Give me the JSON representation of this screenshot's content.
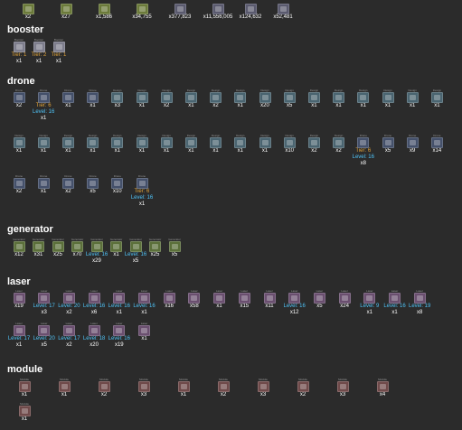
{
  "colors": {
    "background": "#2b2b2b",
    "text": "#ffffff",
    "tier": "#e0a33a",
    "level": "#4fc3f7",
    "label": "#9a9a9a"
  },
  "top_items": [
    {
      "icon": "cube-icon",
      "qty": "x2"
    },
    {
      "icon": "cube-icon",
      "qty": "x27"
    },
    {
      "icon": "cube-icon",
      "qty": "x1,586"
    },
    {
      "icon": "cube-icon",
      "qty": "x34,755"
    },
    {
      "icon": "ammo-icon",
      "qty": "x377,823"
    },
    {
      "icon": "ammo-icon",
      "qty": "x11,556,005"
    },
    {
      "icon": "ammo-icon",
      "qty": "x124,632"
    },
    {
      "icon": "ammo-icon",
      "qty": "x52,481"
    }
  ],
  "sections": {
    "booster": {
      "title": "booster",
      "items": [
        {
          "label": "Booster",
          "icon": "booster-icon",
          "tier": "Tier: 1",
          "qty": "x1"
        },
        {
          "label": "Booster",
          "icon": "booster-icon",
          "tier": "Tier: 2",
          "qty": "x1"
        },
        {
          "label": "Booster",
          "icon": "booster-icon",
          "tier": "Tier: 1",
          "qty": "x1"
        }
      ]
    },
    "drone": {
      "title": "drone",
      "rows": [
        [
          {
            "label": "Drone",
            "icon": "drone-icon",
            "qty": "x2"
          },
          {
            "label": "Drone",
            "icon": "drone-icon",
            "tier": "Tier: 6",
            "level": "Level: 16",
            "qty": "x1"
          },
          {
            "label": "Drone",
            "icon": "drone-icon",
            "qty": "x1"
          },
          {
            "label": "Drone",
            "icon": "drone-icon",
            "qty": "x1"
          },
          {
            "label": "Design",
            "icon": "design-icon",
            "qty": "x3"
          },
          {
            "label": "Design",
            "icon": "design-icon",
            "qty": "x1"
          },
          {
            "label": "Design",
            "icon": "design-icon",
            "qty": "x2"
          },
          {
            "label": "Design",
            "icon": "design-icon",
            "qty": "x1"
          },
          {
            "label": "Design",
            "icon": "design-icon",
            "qty": "x2"
          },
          {
            "label": "Design",
            "icon": "design-icon",
            "qty": "x1"
          },
          {
            "label": "Design",
            "icon": "design-icon",
            "qty": "x20"
          },
          {
            "label": "Design",
            "icon": "design-icon",
            "qty": "x5"
          },
          {
            "label": "Design",
            "icon": "design-icon",
            "qty": "x1"
          },
          {
            "label": "Design",
            "icon": "design-icon",
            "qty": "x1"
          },
          {
            "label": "Design",
            "icon": "design-icon",
            "qty": "x1"
          },
          {
            "label": "Design",
            "icon": "design-icon",
            "qty": "x1"
          },
          {
            "label": "Design",
            "icon": "design-icon",
            "qty": "x1"
          },
          {
            "label": "Design",
            "icon": "design-icon",
            "qty": "x1"
          }
        ],
        [
          {
            "label": "Design",
            "icon": "design-icon",
            "qty": "x1"
          },
          {
            "label": "Design",
            "icon": "design-icon",
            "qty": "x1"
          },
          {
            "label": "Design",
            "icon": "design-icon",
            "qty": "x1"
          },
          {
            "label": "Design",
            "icon": "design-icon",
            "qty": "x1"
          },
          {
            "label": "Design",
            "icon": "design-icon",
            "qty": "x1"
          },
          {
            "label": "Design",
            "icon": "design-icon",
            "qty": "x1"
          },
          {
            "label": "Design",
            "icon": "design-icon",
            "qty": "x1"
          },
          {
            "label": "Design",
            "icon": "design-icon",
            "qty": "x1"
          },
          {
            "label": "Design",
            "icon": "design-icon",
            "qty": "x1"
          },
          {
            "label": "Design",
            "icon": "design-icon",
            "qty": "x1"
          },
          {
            "label": "Design",
            "icon": "design-icon",
            "qty": "x1"
          },
          {
            "label": "Design",
            "icon": "design-icon",
            "qty": "x10"
          },
          {
            "label": "Design",
            "icon": "design-icon",
            "qty": "x2"
          },
          {
            "label": "Design",
            "icon": "design-icon",
            "qty": "x2"
          },
          {
            "label": "Drone",
            "icon": "drone-icon",
            "tier": "Tier: 6",
            "level": "Level: 16",
            "qty": "x8"
          },
          {
            "label": "Drone",
            "icon": "drone-icon",
            "qty": "x5"
          },
          {
            "label": "Drone",
            "icon": "drone-icon",
            "qty": "x9"
          },
          {
            "label": "Drone",
            "icon": "drone-icon",
            "qty": "x14"
          }
        ],
        [
          {
            "label": "Drone",
            "icon": "drone-icon",
            "qty": "x2"
          },
          {
            "label": "Drone",
            "icon": "drone-icon",
            "qty": "x1"
          },
          {
            "label": "Drone",
            "icon": "drone-icon",
            "qty": "x2"
          },
          {
            "label": "Drone",
            "icon": "drone-icon",
            "qty": "x5"
          },
          {
            "label": "Drone",
            "icon": "drone-icon",
            "qty": "x10"
          },
          {
            "label": "Drone",
            "icon": "drone-icon",
            "tier": "Tier: 6",
            "level": "Level: 16",
            "qty": "x1"
          }
        ]
      ]
    },
    "generator": {
      "title": "generator",
      "items": [
        {
          "label": "Generator",
          "icon": "generator-icon",
          "qty": "x12"
        },
        {
          "label": "Generator",
          "icon": "generator-icon",
          "qty": "x31"
        },
        {
          "label": "Generator",
          "icon": "generator-icon",
          "qty": "x25"
        },
        {
          "label": "Generator",
          "icon": "generator-icon",
          "qty": "x70"
        },
        {
          "label": "Generator",
          "icon": "generator-icon",
          "level": "Level: 16",
          "qty": "x29"
        },
        {
          "label": "Generator",
          "icon": "generator-icon",
          "qty": "x1"
        },
        {
          "label": "Generator",
          "icon": "generator-icon",
          "level": "Level: 16",
          "qty": "x5"
        },
        {
          "label": "Generator",
          "icon": "generator-icon",
          "qty": "x25"
        },
        {
          "label": "Generator",
          "icon": "generator-icon",
          "qty": "x5"
        }
      ]
    },
    "laser": {
      "title": "laser",
      "rows": [
        [
          {
            "label": "Laser",
            "icon": "laser-icon",
            "qty": "x19"
          },
          {
            "label": "Laser",
            "icon": "laser-icon",
            "level": "Level: 17",
            "qty": "x3"
          },
          {
            "label": "Laser",
            "icon": "laser-icon",
            "level": "Level: 20",
            "qty": "x2"
          },
          {
            "label": "Laser",
            "icon": "laser-icon",
            "level": "Level: 16",
            "qty": "x6"
          },
          {
            "label": "Laser",
            "icon": "laser-icon",
            "level": "Level: 16",
            "qty": "x1"
          },
          {
            "label": "Laser",
            "icon": "laser-icon",
            "level": "Level: 16",
            "qty": "x1"
          },
          {
            "label": "Laser",
            "icon": "laser-icon",
            "qty": "x16"
          },
          {
            "label": "Laser",
            "icon": "laser-icon",
            "qty": "x58"
          },
          {
            "label": "Laser",
            "icon": "laser-icon",
            "qty": "x1"
          },
          {
            "label": "Laser",
            "icon": "laser-icon",
            "qty": "x15"
          },
          {
            "label": "Laser",
            "icon": "laser-icon",
            "qty": "x11"
          },
          {
            "label": "Laser",
            "icon": "laser-icon",
            "level": "Level: 16",
            "qty": "x12"
          },
          {
            "label": "Laser",
            "icon": "laser-icon",
            "qty": "x5"
          },
          {
            "label": "Laser",
            "icon": "laser-icon",
            "qty": "x24"
          },
          {
            "label": "Laser",
            "icon": "laser-icon",
            "level": "Level: 9",
            "qty": "x1"
          },
          {
            "label": "Laser",
            "icon": "laser-icon",
            "level": "Level: 16",
            "qty": "x1"
          },
          {
            "label": "Laser",
            "icon": "laser-icon",
            "level": "Level: 19",
            "qty": "x8"
          }
        ],
        [
          {
            "label": "Laser",
            "icon": "laser-icon",
            "level": "Level: 17",
            "qty": "x1"
          },
          {
            "label": "Laser",
            "icon": "laser-icon",
            "level": "Level: 20",
            "qty": "x5"
          },
          {
            "label": "Laser",
            "icon": "laser-icon",
            "level": "Level: 17",
            "qty": "x2"
          },
          {
            "label": "Laser",
            "icon": "laser-icon",
            "level": "Level: 18",
            "qty": "x20"
          },
          {
            "label": "Laser",
            "icon": "laser-icon",
            "level": "Level: 16",
            "qty": "x19"
          },
          {
            "label": "Laser",
            "icon": "laser-icon",
            "qty": "x1"
          }
        ]
      ]
    },
    "module": {
      "title": "module",
      "rows": [
        [
          {
            "label": "Module",
            "icon": "module-icon",
            "qty": "x1"
          },
          {
            "label": "Module",
            "icon": "module-icon",
            "qty": "x1"
          },
          {
            "label": "Module",
            "icon": "module-icon",
            "qty": "x2"
          },
          {
            "label": "Module",
            "icon": "module-icon",
            "qty": "x3"
          },
          {
            "label": "Module",
            "icon": "module-icon",
            "qty": "x1"
          },
          {
            "label": "Module",
            "icon": "module-icon",
            "qty": "x2"
          },
          {
            "label": "Module",
            "icon": "module-icon",
            "qty": "x3"
          },
          {
            "label": "Module",
            "icon": "module-icon",
            "qty": "x2"
          },
          {
            "label": "Module",
            "icon": "module-icon",
            "qty": "x3"
          },
          {
            "label": "Module",
            "icon": "module-icon",
            "qty": "x4"
          }
        ],
        [
          {
            "label": "Module",
            "icon": "module-icon",
            "qty": "x1"
          }
        ]
      ]
    }
  }
}
